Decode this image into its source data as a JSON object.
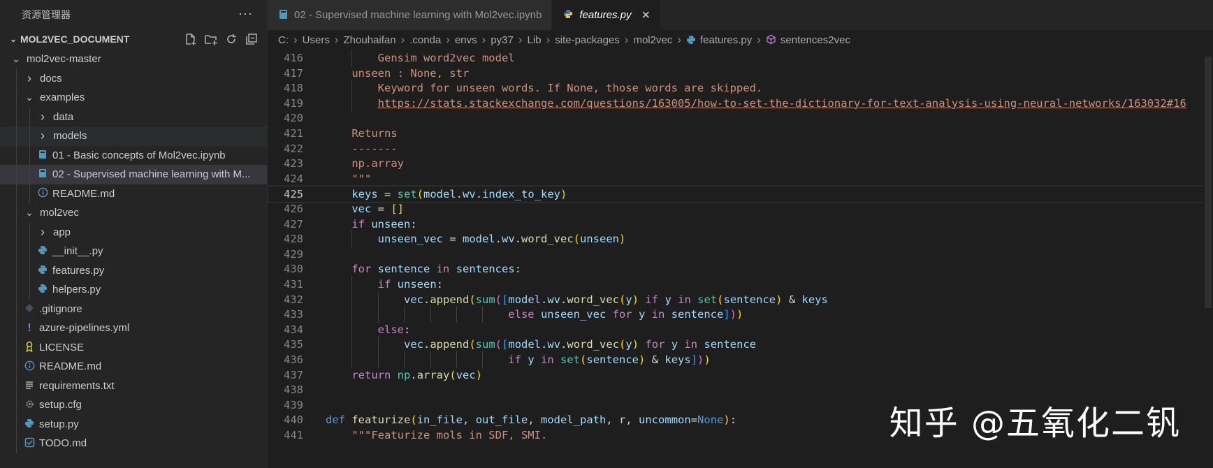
{
  "sidebar": {
    "title": "资源管理器",
    "more_label": "···",
    "section_title": "MOL2VEC_DOCUMENT",
    "actions": [
      "new-file-icon",
      "new-folder-icon",
      "refresh-icon",
      "collapse-icon"
    ],
    "items": [
      {
        "label": "mol2vec-master",
        "type": "folder-open",
        "depth": 1
      },
      {
        "label": "docs",
        "type": "folder",
        "depth": 2
      },
      {
        "label": "examples",
        "type": "folder-open",
        "depth": 2
      },
      {
        "label": "data",
        "type": "folder",
        "depth": 3
      },
      {
        "label": "models",
        "type": "folder",
        "depth": 3
      },
      {
        "label": "01 - Basic concepts of Mol2vec.ipynb",
        "type": "notebook",
        "depth": 3
      },
      {
        "label": "02 - Supervised machine learning with M...",
        "type": "notebook",
        "depth": 3
      },
      {
        "label": "README.md",
        "type": "info",
        "depth": 3
      },
      {
        "label": "mol2vec",
        "type": "folder-open",
        "depth": 2
      },
      {
        "label": "app",
        "type": "folder",
        "depth": 3
      },
      {
        "label": "__init__.py",
        "type": "python",
        "depth": 3
      },
      {
        "label": "features.py",
        "type": "python",
        "depth": 3
      },
      {
        "label": "helpers.py",
        "type": "python",
        "depth": 3
      },
      {
        "label": ".gitignore",
        "type": "git",
        "depth": 2
      },
      {
        "label": "azure-pipelines.yml",
        "type": "yaml",
        "depth": 2
      },
      {
        "label": "LICENSE",
        "type": "license",
        "depth": 2
      },
      {
        "label": "README.md",
        "type": "info",
        "depth": 2
      },
      {
        "label": "requirements.txt",
        "type": "text",
        "depth": 2
      },
      {
        "label": "setup.cfg",
        "type": "gear",
        "depth": 2
      },
      {
        "label": "setup.py",
        "type": "python",
        "depth": 2
      },
      {
        "label": "TODO.md",
        "type": "todo",
        "depth": 2
      }
    ]
  },
  "tabs": [
    {
      "label": "02 - Supervised machine learning with Mol2vec.ipynb",
      "icon": "notebook-icon",
      "active": false
    },
    {
      "label": "features.py",
      "icon": "python-icon",
      "active": true,
      "close": "✕"
    }
  ],
  "breadcrumb": [
    "C:",
    "Users",
    "Zhouhaifan",
    ".conda",
    "envs",
    "py37",
    "Lib",
    "site-packages",
    "mol2vec",
    "features.py",
    "sentences2vec"
  ],
  "code": {
    "current_line": 425,
    "lines": [
      {
        "n": 416,
        "text": "        Gensim word2vec model"
      },
      {
        "n": 417,
        "text": "    unseen : None, str"
      },
      {
        "n": 418,
        "text": "        Keyword for unseen words. If None, those words are skipped."
      },
      {
        "n": 419,
        "text": "        https://stats.stackexchange.com/questions/163005/how-to-set-the-dictionary-for-text-analysis-using-neural-networks/163032#16"
      },
      {
        "n": 420,
        "text": ""
      },
      {
        "n": 421,
        "text": "    Returns"
      },
      {
        "n": 422,
        "text": "    -------"
      },
      {
        "n": 423,
        "text": "    np.array"
      },
      {
        "n": 424,
        "text": "    \"\"\""
      },
      {
        "n": 425,
        "text": "    keys = set(model.wv.index_to_key)"
      },
      {
        "n": 426,
        "text": "    vec = []"
      },
      {
        "n": 427,
        "text": "    if unseen:"
      },
      {
        "n": 428,
        "text": "        unseen_vec = model.wv.word_vec(unseen)"
      },
      {
        "n": 429,
        "text": ""
      },
      {
        "n": 430,
        "text": "    for sentence in sentences:"
      },
      {
        "n": 431,
        "text": "        if unseen:"
      },
      {
        "n": 432,
        "text": "            vec.append(sum([model.wv.word_vec(y) if y in set(sentence) & keys"
      },
      {
        "n": 433,
        "text": "                            else unseen_vec for y in sentence]))"
      },
      {
        "n": 434,
        "text": "        else:"
      },
      {
        "n": 435,
        "text": "            vec.append(sum([model.wv.word_vec(y) for y in sentence"
      },
      {
        "n": 436,
        "text": "                            if y in set(sentence) & keys]))"
      },
      {
        "n": 437,
        "text": "    return np.array(vec)"
      },
      {
        "n": 438,
        "text": ""
      },
      {
        "n": 439,
        "text": ""
      },
      {
        "n": 440,
        "text": "def featurize(in_file, out_file, model_path, r, uncommon=None):"
      },
      {
        "n": 441,
        "text": "    \"\"\"Featurize mols in SDF, SMI."
      }
    ]
  },
  "watermark": "知乎 @五氧化二钒"
}
